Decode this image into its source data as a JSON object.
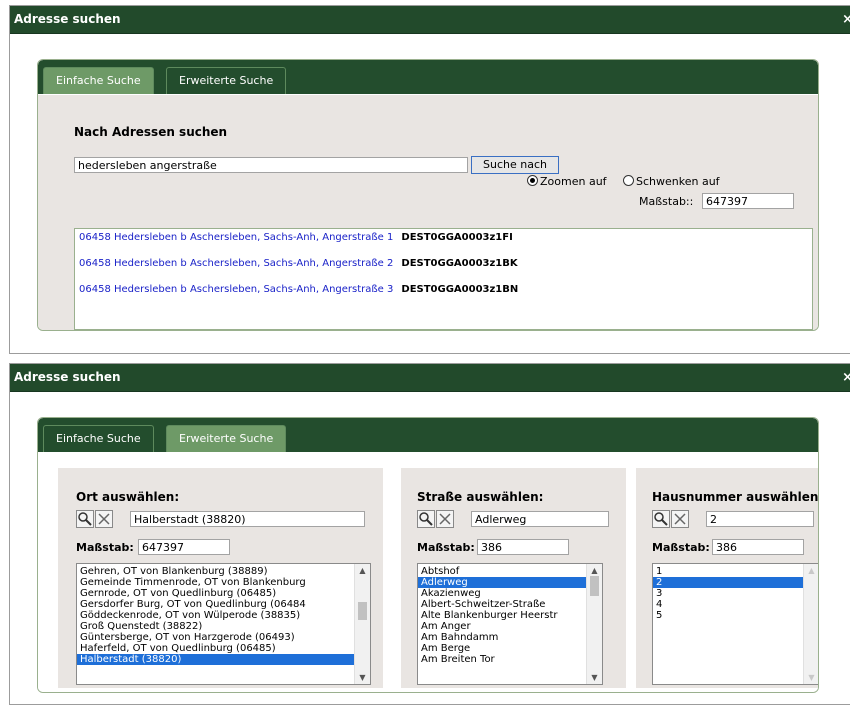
{
  "dialog1": {
    "title": "Adresse suchen",
    "close": "×",
    "tabs": [
      "Einfache Suche",
      "Erweiterte Suche"
    ],
    "heading": "Nach Adressen suchen",
    "search_value": "hedersleben angerstraße",
    "search_button": "Suche nach",
    "radio_zoom": "Zoomen auf",
    "radio_pan": "Schwenken auf",
    "scale_label": "Maßstab::",
    "scale_value": "647397",
    "results": [
      {
        "address": "06458 Hedersleben b Aschersleben, Sachs-Anh, Angerstraße 1",
        "code": "DEST0GGA0003z1FI"
      },
      {
        "address": "06458 Hedersleben b Aschersleben, Sachs-Anh, Angerstraße 2",
        "code": "DEST0GGA0003z1BK"
      },
      {
        "address": "06458 Hedersleben b Aschersleben, Sachs-Anh, Angerstraße 3",
        "code": "DEST0GGA0003z1BN"
      }
    ]
  },
  "dialog2": {
    "title": "Adresse suchen",
    "close": "×",
    "tabs": [
      "Einfache Suche",
      "Erweiterte Suche"
    ],
    "ort": {
      "heading": "Ort auswählen:",
      "value": "Halberstadt (38820)",
      "scale_label": "Maßstab:",
      "scale_value": "647397",
      "items": [
        "Gehren, OT von Blankenburg (38889)",
        "Gemeinde Timmenrode, OT von Blankenburg",
        "Gernrode, OT von Quedlinburg (06485)",
        "Gersdorfer Burg, OT von Quedlinburg (06484",
        "Göddeckenrode, OT von Wülperode (38835)",
        "Groß Quenstedt (38822)",
        "Güntersberge, OT von Harzgerode (06493)",
        "Haferfeld, OT von Quedlinburg (06485)",
        "Halberstadt (38820)"
      ],
      "selected": 8
    },
    "strasse": {
      "heading": "Straße auswählen:",
      "value": "Adlerweg",
      "scale_label": "Maßstab:",
      "scale_value": "386",
      "items": [
        "Abtshof",
        "Adlerweg",
        "Akazienweg",
        "Albert-Schweitzer-Straße",
        "Alte Blankenburger Heerstr",
        "Am Anger",
        "Am Bahndamm",
        "Am Berge",
        "Am Breiten Tor"
      ],
      "selected": 1
    },
    "hausnummer": {
      "heading": "Hausnummer auswählen",
      "value": "2",
      "scale_label": "Maßstab:",
      "scale_value": "386",
      "items": [
        "1",
        "2",
        "3",
        "4",
        "5"
      ],
      "selected": 1
    }
  }
}
